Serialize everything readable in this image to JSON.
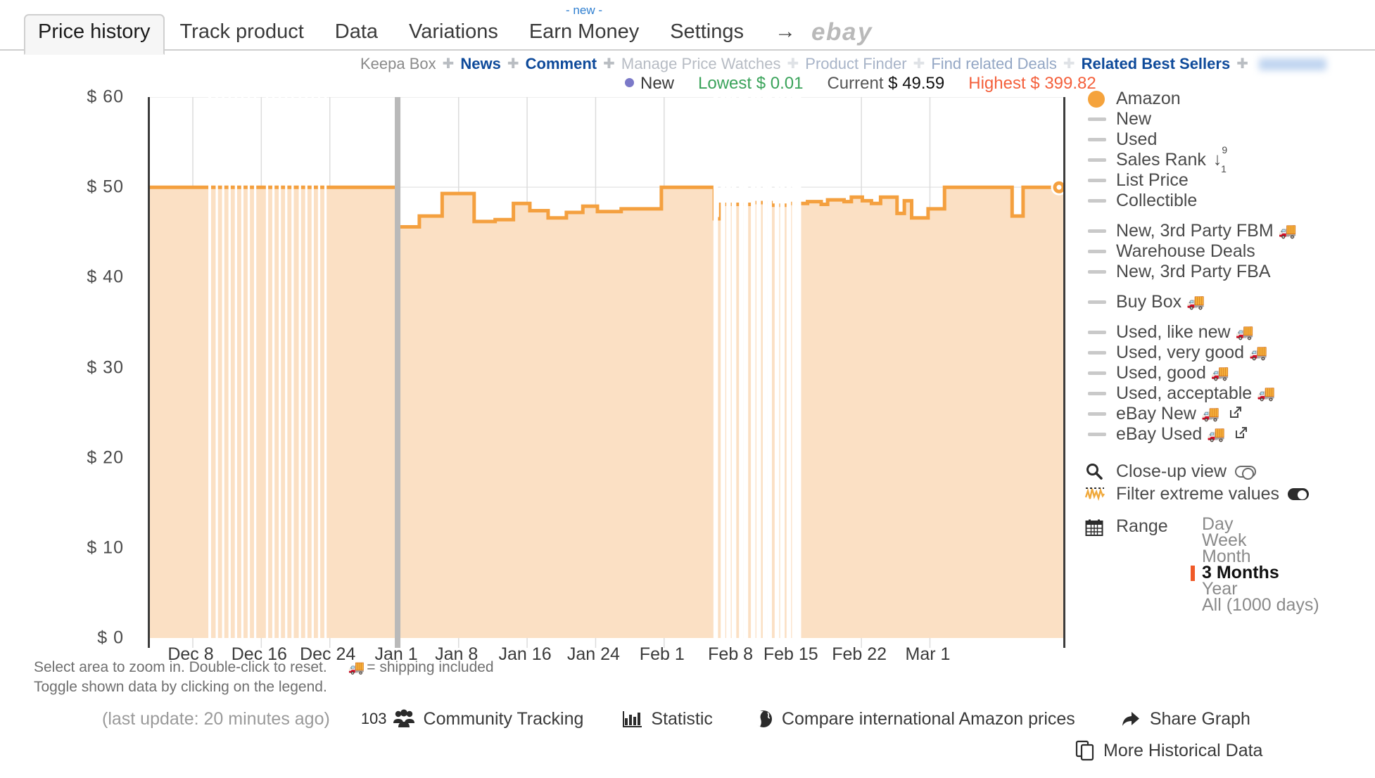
{
  "tabs": [
    {
      "label": "Price history",
      "active": true
    },
    {
      "label": "Track product",
      "active": false
    },
    {
      "label": "Data",
      "active": false
    },
    {
      "label": "Variations",
      "active": false
    },
    {
      "label": "Earn Money",
      "active": false,
      "flag": "- new -"
    },
    {
      "label": "Settings",
      "active": false
    }
  ],
  "arrow": "→",
  "brand_logo": "ebay",
  "subnav": [
    {
      "label": "Keepa Box",
      "style": "sn-grey"
    },
    {
      "label": "News",
      "style": "sn-blue"
    },
    {
      "label": "Comment",
      "style": "sn-blue"
    },
    {
      "label": "Manage Price Watches",
      "style": "sn-fade1"
    },
    {
      "label": "Product Finder",
      "style": "sn-fade2"
    },
    {
      "label": "Find related Deals",
      "style": "sn-fade3"
    },
    {
      "label": "Related Best Sellers",
      "style": "sn-blue"
    }
  ],
  "stats": {
    "series_name": "New",
    "lowest_label": "Lowest",
    "lowest_value": "$ 0.01",
    "current_label": "Current",
    "current_value": "$ 49.59",
    "highest_label": "Highest",
    "highest_value": "$ 399.82"
  },
  "legend": {
    "items": [
      {
        "label": "Amazon",
        "marker": "dot",
        "color": "#f5a33c"
      },
      {
        "label": "New",
        "marker": "dash"
      },
      {
        "label": "Used",
        "marker": "dash"
      },
      {
        "label": "Sales Rank",
        "marker": "dash",
        "rank_icon": true
      },
      {
        "label": "List Price",
        "marker": "dash"
      },
      {
        "label": "Collectible",
        "marker": "dash"
      },
      {
        "label": "New, 3rd Party FBM",
        "marker": "dash",
        "truck": true,
        "gap_before": true
      },
      {
        "label": "Warehouse Deals",
        "marker": "dash"
      },
      {
        "label": "New, 3rd Party FBA",
        "marker": "dash"
      },
      {
        "label": "Buy Box",
        "marker": "dash",
        "truck": true,
        "gap_before": true
      },
      {
        "label": "Used, like new",
        "marker": "dash",
        "truck": true,
        "gap_before": true
      },
      {
        "label": "Used, very good",
        "marker": "dash",
        "truck": true
      },
      {
        "label": "Used, good",
        "marker": "dash",
        "truck": true
      },
      {
        "label": "Used, acceptable",
        "marker": "dash",
        "truck": true
      },
      {
        "label": "eBay New",
        "marker": "dash",
        "truck": true,
        "ext": true
      },
      {
        "label": "eBay Used",
        "marker": "dash",
        "truck": true,
        "ext": true
      }
    ],
    "rank_sup": "9",
    "rank_sub": "1",
    "options": [
      {
        "label": "Close-up view",
        "icon": "magnifier-icon",
        "toggle": "off"
      },
      {
        "label": "Filter extreme values",
        "icon": "waveform-icon",
        "toggle": "on"
      }
    ],
    "range": {
      "title": "Range",
      "icon": "calendar-icon",
      "options": [
        {
          "label": "Day",
          "selected": false
        },
        {
          "label": "Week",
          "selected": false
        },
        {
          "label": "Month",
          "selected": false
        },
        {
          "label": "3 Months",
          "selected": true
        },
        {
          "label": "Year",
          "selected": false
        },
        {
          "label": "All (1000 days)",
          "selected": false
        }
      ],
      "accent": "#f05a28"
    }
  },
  "hints": {
    "line1": "Select area to zoom in. Double-click to reset.",
    "shipping": "= shipping included",
    "line2": "Toggle shown data by clicking on the legend."
  },
  "bottom": {
    "last_update": "(last update: 20 minutes ago)",
    "community_count": "103",
    "community_label": "Community Tracking",
    "statistic_label": "Statistic",
    "compare_label": "Compare international Amazon prices",
    "share_label": "Share Graph",
    "more_label": "More Historical Data"
  },
  "chart_data": {
    "type": "area",
    "title": "Amazon price history",
    "xlabel": "",
    "ylabel": "",
    "ylim": [
      0,
      60
    ],
    "yticks": [
      0,
      10,
      20,
      30,
      40,
      50,
      60
    ],
    "ytick_labels": [
      "$ 0",
      "$ 10",
      "$ 20",
      "$ 30",
      "$ 40",
      "$ 50",
      "$ 60"
    ],
    "xtick_labels": [
      "Dec 8",
      "Dec 16",
      "Dec 24",
      "Jan 1",
      "Jan 8",
      "Jan 16",
      "Jan 24",
      "Feb 1",
      "Feb 8",
      "Feb 15",
      "Feb 22",
      "Mar 1"
    ],
    "xtick_positions": [
      0.047,
      0.122,
      0.197,
      0.272,
      0.338,
      0.413,
      0.488,
      0.563,
      0.638,
      0.704,
      0.779,
      0.854
    ],
    "grid": true,
    "legend_position": "right",
    "series": [
      {
        "name": "Amazon",
        "color": "#f4a03f",
        "fill": "#fbe0c4",
        "points": [
          [
            0.0,
            49.99
          ],
          [
            0.04,
            49.99
          ],
          [
            0.045,
            49.99
          ],
          [
            0.09,
            49.99
          ],
          [
            0.13,
            49.99
          ],
          [
            0.16,
            49.99
          ],
          [
            0.2,
            49.99
          ],
          [
            0.205,
            49.99
          ],
          [
            0.24,
            49.99
          ],
          [
            0.27,
            49.99
          ],
          [
            0.272,
            45.6
          ],
          [
            0.285,
            45.6
          ],
          [
            0.292,
            45.6
          ],
          [
            0.295,
            46.8
          ],
          [
            0.318,
            46.8
          ],
          [
            0.32,
            49.3
          ],
          [
            0.352,
            49.3
          ],
          [
            0.355,
            46.2
          ],
          [
            0.372,
            46.2
          ],
          [
            0.378,
            46.4
          ],
          [
            0.392,
            46.4
          ],
          [
            0.398,
            48.2
          ],
          [
            0.412,
            48.2
          ],
          [
            0.416,
            47.4
          ],
          [
            0.432,
            47.4
          ],
          [
            0.436,
            46.6
          ],
          [
            0.452,
            46.6
          ],
          [
            0.456,
            47.2
          ],
          [
            0.47,
            47.2
          ],
          [
            0.474,
            47.9
          ],
          [
            0.486,
            47.9
          ],
          [
            0.49,
            47.3
          ],
          [
            0.512,
            47.3
          ],
          [
            0.516,
            47.6
          ],
          [
            0.556,
            47.6
          ],
          [
            0.56,
            49.99
          ],
          [
            0.615,
            49.99
          ],
          [
            0.618,
            46.5
          ],
          [
            0.625,
            48.1
          ],
          [
            0.64,
            48.1
          ],
          [
            0.66,
            48.3
          ],
          [
            0.68,
            48.0
          ],
          [
            0.7,
            48.2
          ],
          [
            0.72,
            48.4
          ],
          [
            0.735,
            48.1
          ],
          [
            0.742,
            48.6
          ],
          [
            0.76,
            48.4
          ],
          [
            0.768,
            48.9
          ],
          [
            0.78,
            48.5
          ],
          [
            0.79,
            48.2
          ],
          [
            0.8,
            48.9
          ],
          [
            0.812,
            48.9
          ],
          [
            0.818,
            47.1
          ],
          [
            0.826,
            48.5
          ],
          [
            0.834,
            46.6
          ],
          [
            0.848,
            46.6
          ],
          [
            0.852,
            47.6
          ],
          [
            0.866,
            47.6
          ],
          [
            0.87,
            49.99
          ],
          [
            0.94,
            49.99
          ],
          [
            0.944,
            46.8
          ],
          [
            0.952,
            46.8
          ],
          [
            0.956,
            49.99
          ],
          [
            1.0,
            49.99
          ]
        ]
      }
    ],
    "out_of_stock_bands": [
      [
        0.064,
        0.067
      ],
      [
        0.072,
        0.0745
      ],
      [
        0.079,
        0.0815
      ],
      [
        0.086,
        0.0885
      ],
      [
        0.093,
        0.0955
      ],
      [
        0.1,
        0.1025
      ],
      [
        0.107,
        0.1095
      ],
      [
        0.114,
        0.1165
      ],
      [
        0.127,
        0.1295
      ],
      [
        0.134,
        0.1365
      ],
      [
        0.141,
        0.1435
      ],
      [
        0.148,
        0.1505
      ],
      [
        0.155,
        0.1575
      ],
      [
        0.163,
        0.1655
      ],
      [
        0.17,
        0.1725
      ],
      [
        0.177,
        0.1795
      ],
      [
        0.184,
        0.1865
      ],
      [
        0.191,
        0.1935
      ],
      [
        0.625,
        0.63
      ],
      [
        0.637,
        0.642
      ],
      [
        0.65,
        0.655
      ],
      [
        0.664,
        0.669
      ],
      [
        0.676,
        0.681
      ],
      [
        0.69,
        0.695
      ],
      [
        0.703,
        0.708
      ]
    ],
    "marker_line_x": 0.272,
    "end_marker": {
      "x": 1.0,
      "y": 49.99,
      "color": "#f4a03f"
    }
  }
}
